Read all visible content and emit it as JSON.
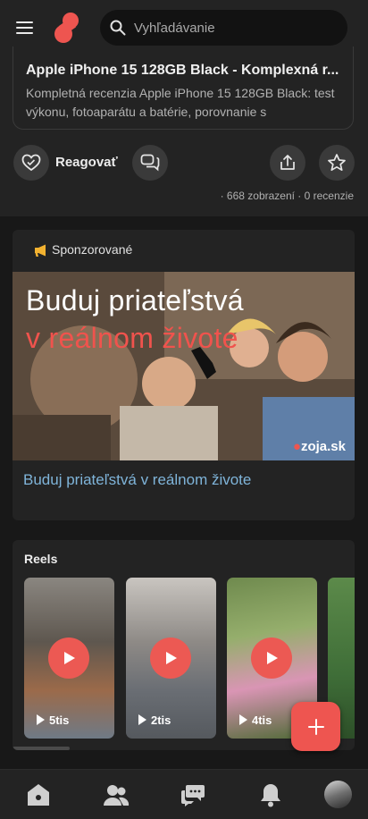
{
  "header": {
    "menu_icon": "hamburger-menu-icon",
    "logo_icon": "app-logo",
    "search_placeholder": "Vyhľadávanie"
  },
  "post": {
    "link_title": "Apple iPhone 15 128GB Black - Komplexná r...",
    "link_description": "Kompletná recenzia Apple iPhone 15 128GB Black: test výkonu, fotoaparátu a batérie, porovnanie s konkurencio...",
    "react_label": "Reagovať",
    "stats": "· 668 zobrazení · 0 recenzie",
    "icons": [
      "heart-react-icon",
      "comments-icon",
      "share-icon",
      "star-icon"
    ]
  },
  "sponsored": {
    "label": "Sponzorované",
    "ad_line1": "Buduj priateľstvá",
    "ad_line2": "v reálnom živote",
    "ad_brand": "zoja.sk",
    "ad_link": "Buduj priateľstvá v reálnom živote"
  },
  "reels": {
    "title": "Reels",
    "items": [
      {
        "views": "5tis"
      },
      {
        "views": "2tis"
      },
      {
        "views": "4tis"
      },
      {
        "views": ""
      }
    ]
  },
  "fab_label": "+",
  "bottom_nav": [
    "home-icon",
    "friends-icon",
    "messages-icon",
    "notifications-icon",
    "profile-avatar"
  ],
  "colors": {
    "accent": "#ee5550",
    "background": "#181818",
    "surface": "#232323",
    "link": "#7fb4d9"
  }
}
